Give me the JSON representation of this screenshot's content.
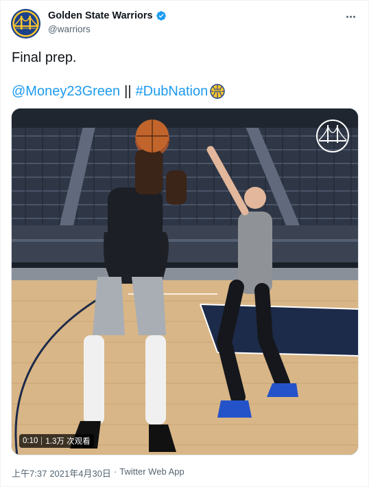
{
  "author": {
    "display_name": "Golden State Warriors",
    "handle": "@warriors",
    "verified": true,
    "avatar_icon": "warriors-bridge-logo"
  },
  "tweet": {
    "text": "Final prep.",
    "mention": "@Money23Green",
    "separator": "||",
    "hashtag": "#DubNation",
    "hashflag_icon": "dubnation-basketball-icon"
  },
  "media": {
    "type": "video",
    "duration": "0:10",
    "views": "1.3万 次观看",
    "watermark_icon": "warriors-bridge-logo"
  },
  "meta": {
    "time": "上午7:37",
    "date": "2021年4月30日",
    "dot": "·",
    "source": "Twitter Web App"
  },
  "colors": {
    "link": "#1d9bf0",
    "warriors_blue": "#1d428a",
    "warriors_gold": "#ffc72c",
    "secondary_text": "#536471"
  }
}
